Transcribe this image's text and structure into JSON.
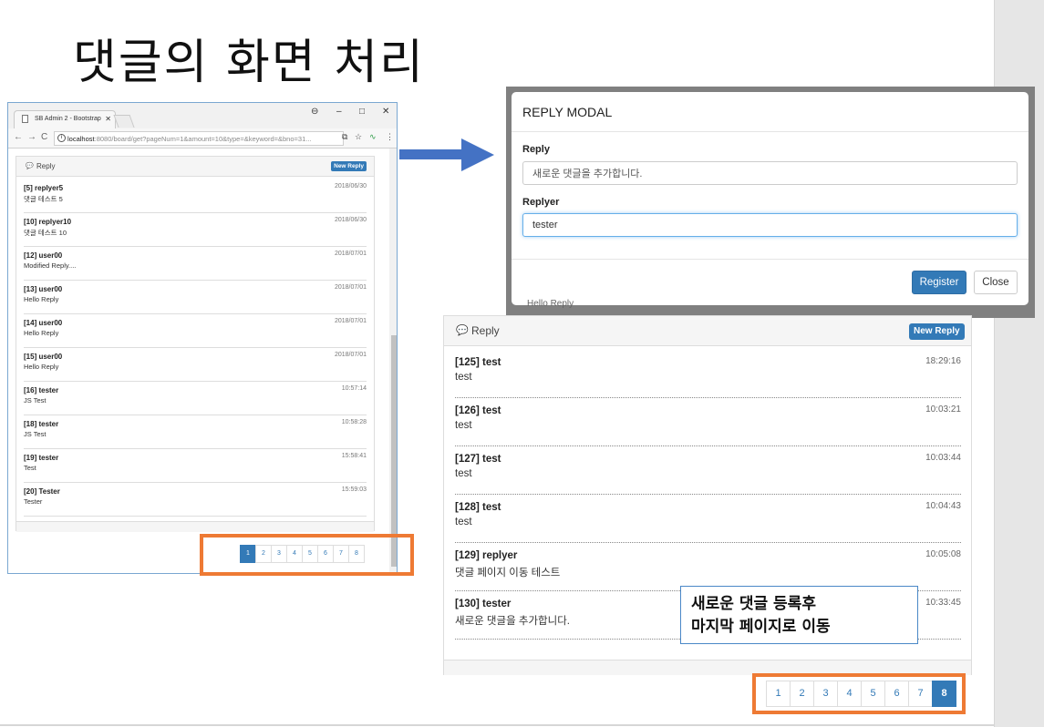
{
  "slide": {
    "title": "댓글의 화면 처리"
  },
  "browser": {
    "tab_title": "SB Admin 2 - Bootstrap",
    "url_host": "localhost",
    "url_rest": ":8080/board/get?pageNum=1&amount=10&type=&keyword=&bno=31...",
    "panel_title": "Reply",
    "new_reply_label": "New Reply",
    "replies": [
      {
        "head": "[5] replyer5",
        "date": "2018/06/30",
        "text": "댓글 테스트 5"
      },
      {
        "head": "[10] replyer10",
        "date": "2018/06/30",
        "text": "댓글 테스트 10"
      },
      {
        "head": "[12] user00",
        "date": "2018/07/01",
        "text": "Modified Reply...."
      },
      {
        "head": "[13] user00",
        "date": "2018/07/01",
        "text": "Hello Reply"
      },
      {
        "head": "[14] user00",
        "date": "2018/07/01",
        "text": "Hello Reply"
      },
      {
        "head": "[15] user00",
        "date": "2018/07/01",
        "text": "Hello Reply"
      },
      {
        "head": "[16] tester",
        "date": "10:57:14",
        "text": "JS Test"
      },
      {
        "head": "[18] tester",
        "date": "10:58:28",
        "text": "JS Test"
      },
      {
        "head": "[19] tester",
        "date": "15:58:41",
        "text": "Test"
      },
      {
        "head": "[20] Tester",
        "date": "15:59:03",
        "text": "Tester"
      }
    ],
    "pages": [
      "1",
      "2",
      "3",
      "4",
      "5",
      "6",
      "7",
      "8"
    ],
    "active_page": "1"
  },
  "modal": {
    "title": "REPLY MODAL",
    "reply_label": "Reply",
    "reply_value": "새로운 댓글을 추가합니다.",
    "replyer_label": "Replyer",
    "replyer_value": "tester",
    "register_label": "Register",
    "close_label": "Close",
    "peek_text": "Hello Reply"
  },
  "reply_panel": {
    "title": "Reply",
    "new_reply_label": "New Reply",
    "replies": [
      {
        "head": "[125] test",
        "date": "18:29:16",
        "text": "test"
      },
      {
        "head": "[126] test",
        "date": "10:03:21",
        "text": "test"
      },
      {
        "head": "[127] test",
        "date": "10:03:44",
        "text": "test"
      },
      {
        "head": "[128] test",
        "date": "10:04:43",
        "text": "test"
      },
      {
        "head": "[129] replyer",
        "date": "10:05:08",
        "text": "댓글 페이지 이동 테스트"
      },
      {
        "head": "[130] tester",
        "date": "10:33:45",
        "text": "새로운 댓글을 추가합니다."
      }
    ],
    "pages": [
      "1",
      "2",
      "3",
      "4",
      "5",
      "6",
      "7",
      "8"
    ],
    "active_page": "8"
  },
  "note": {
    "line1": "새로운 댓글 등록후",
    "line2": "마지막 페이지로 이동"
  },
  "colors": {
    "primary": "#337ab7",
    "highlight": "#ee7a34",
    "arrow": "#4472c4"
  },
  "icons": [
    "document-icon",
    "info-icon",
    "comment-icon",
    "back-icon",
    "forward-icon",
    "reload-icon",
    "translate-icon",
    "star-icon",
    "extension-icon",
    "menu-icon",
    "account-icon"
  ]
}
